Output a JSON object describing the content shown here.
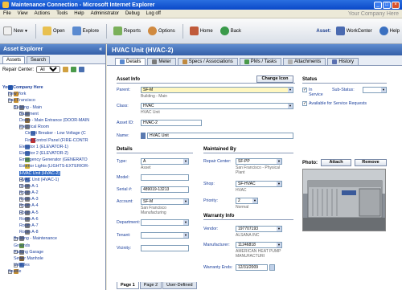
{
  "window": {
    "title": "Maintenance Connection - Microsoft Internet Explorer"
  },
  "menu": {
    "items": [
      "File",
      "View",
      "Actions",
      "Tools",
      "Help",
      "Administrator",
      "Debug",
      "Log off"
    ],
    "company": "Your Company Here"
  },
  "toolbar": {
    "new_label": "New",
    "open_label": "Open",
    "explore_label": "Explore",
    "reports_label": "Reports",
    "options_label": "Options",
    "home_label": "Home",
    "back_label": "Back",
    "asset_label": "Asset:",
    "workcenter_label": "WorkCenter",
    "help_label": "Help"
  },
  "sidebar": {
    "title": "Asset Explorer",
    "tabs": [
      "Assets",
      "Search"
    ],
    "repair_center_label": "Repair Center:",
    "repair_center_value": "All",
    "tree": [
      {
        "label": "Your Company Here",
        "indent": 0,
        "exp": "",
        "color": "#2a5db0",
        "style": "blue"
      },
      {
        "label": "New York",
        "indent": 1,
        "exp": "+",
        "color": "#c89030"
      },
      {
        "label": "San Francisco",
        "indent": 1,
        "exp": "-",
        "color": "#c89030"
      },
      {
        "label": "Building - Main",
        "indent": 2,
        "exp": "-",
        "color": "#7a7a7a"
      },
      {
        "label": "Basement",
        "indent": 3,
        "exp": "+",
        "color": "#7a7a7a"
      },
      {
        "label": "Doors - Main Entrance (DOOR-MAIN",
        "indent": 3,
        "exp": "",
        "color": "#8a6a3a"
      },
      {
        "label": "Electrical Room",
        "indent": 3,
        "exp": "-",
        "color": "#7a7a7a"
      },
      {
        "label": "Circuit Breaker - Low Voltage (C",
        "indent": 4,
        "exp": "",
        "color": "#4a70b0"
      },
      {
        "label": "Fire Control Panel (FIRE-CONTR",
        "indent": 4,
        "exp": "",
        "color": "#c03030"
      },
      {
        "label": "Elevator 1 (ELEVATOR-1)",
        "indent": 3,
        "exp": "",
        "color": "#4a70b0"
      },
      {
        "label": "Elevator 2 (ELEVATOR-2)",
        "indent": 3,
        "exp": "",
        "color": "#4a70b0"
      },
      {
        "label": "Emergency Generator (GENERATO",
        "indent": 3,
        "exp": "",
        "color": "#6a9a40"
      },
      {
        "label": "Exterior Lights (LIGHTS-EXTERIOR-",
        "indent": 3,
        "exp": "",
        "color": "#d0b030"
      },
      {
        "label": "HVAC Unit (HVAC-2)",
        "indent": 3,
        "exp": "+",
        "color": "#5a7ab0",
        "style": "sel"
      },
      {
        "label": "HVAC Unit (HVAC-1)",
        "indent": 3,
        "exp": "+",
        "color": "#5a7ab0"
      },
      {
        "label": "Room A-1",
        "indent": 3,
        "exp": "+",
        "color": "#7a7a7a"
      },
      {
        "label": "Room A-2",
        "indent": 3,
        "exp": "+",
        "color": "#7a7a7a"
      },
      {
        "label": "Room A-3",
        "indent": 3,
        "exp": "+",
        "color": "#7a7a7a"
      },
      {
        "label": "Room A-4",
        "indent": 3,
        "exp": "+",
        "color": "#7a7a7a"
      },
      {
        "label": "Room A-5",
        "indent": 3,
        "exp": "+",
        "color": "#7a7a7a"
      },
      {
        "label": "Room A-6",
        "indent": 3,
        "exp": "",
        "color": "#7a7a7a"
      },
      {
        "label": "Room A-7",
        "indent": 3,
        "exp": "",
        "color": "#7a7a7a"
      },
      {
        "label": "Room A-8",
        "indent": 3,
        "exp": "",
        "color": "#7a7a7a"
      },
      {
        "label": "Building - Maintenance",
        "indent": 2,
        "exp": "+",
        "color": "#7a7a7a"
      },
      {
        "label": "Grounds",
        "indent": 2,
        "exp": "",
        "color": "#6a9a40"
      },
      {
        "label": "Parking Garage",
        "indent": 2,
        "exp": "+",
        "color": "#7a7a7a"
      },
      {
        "label": "Sewer Manhole",
        "indent": 2,
        "exp": "",
        "color": "#8a6a3a"
      },
      {
        "label": "Vehicles",
        "indent": 2,
        "exp": "+",
        "color": "#4a70b0"
      },
      {
        "label": "Seattle",
        "indent": 1,
        "exp": "+",
        "color": "#c89030"
      }
    ]
  },
  "main": {
    "title": "HVAC Unit (HVAC-2)",
    "tabs": [
      "Details",
      "Meter",
      "Specs / Associations",
      "PMs / Tasks",
      "Attachments",
      "History"
    ],
    "asset_info": {
      "title": "Asset Info",
      "change_icon_label": "Change Icon",
      "parent_label": "Parent:",
      "parent_value": "SF-M",
      "parent_sub": "Building - Main",
      "class_label": "Class:",
      "class_value": "HVAC",
      "class_sub": "HVAC Unit",
      "asset_id_label": "Asset ID:",
      "asset_id_value": "HVAC-2",
      "name_label": "Name:",
      "name_value": "HVAC Unit"
    },
    "status": {
      "title": "Status",
      "in_service_label": "In Service",
      "sub_status_label": "Sub-Status:",
      "available_label": "Available for Service Requests"
    },
    "photo": {
      "title": "Photo:",
      "attach_label": "Attach",
      "remove_label": "Remove"
    },
    "details": {
      "title": "Details",
      "type_label": "Type:",
      "type_value": "A",
      "type_sub": "Asset",
      "model_label": "Model:",
      "serial_label": "Serial #:",
      "serial_value": "489019-13213",
      "account_label": "Account:",
      "account_value": "SF-M",
      "account_sub": "San Francisco Manufacturing",
      "department_label": "Department:",
      "tenant_label": "Tenant:",
      "vicinity_label": "Vicinity:"
    },
    "maintained_by": {
      "title": "Maintained By",
      "repair_center_label": "Repair Center:",
      "repair_center_value": "SF-PP",
      "repair_center_sub": "San Francisco - Physical Plant",
      "shop_label": "Shop:",
      "shop_value": "SF-HVAC",
      "shop_sub": "HVAC",
      "priority_label": "Priority:",
      "priority_value": "2",
      "priority_sub": "Normal"
    },
    "warranty": {
      "title": "Warranty Info",
      "vendor_label": "Vendor:",
      "vendor_value": "197707193",
      "vendor_sub": "ALSANA INC",
      "manufacturer_label": "Manufacturer:",
      "manufacturer_value": "11246818",
      "manufacturer_sub": "AMERICAN HEAT PUMP MANUFACTURI",
      "warranty_ends_label": "Warranty Ends:",
      "warranty_ends_value": "12/31/2009"
    },
    "bottom_tabs": [
      "Page 1",
      "Page 2",
      "User-Defined"
    ]
  }
}
